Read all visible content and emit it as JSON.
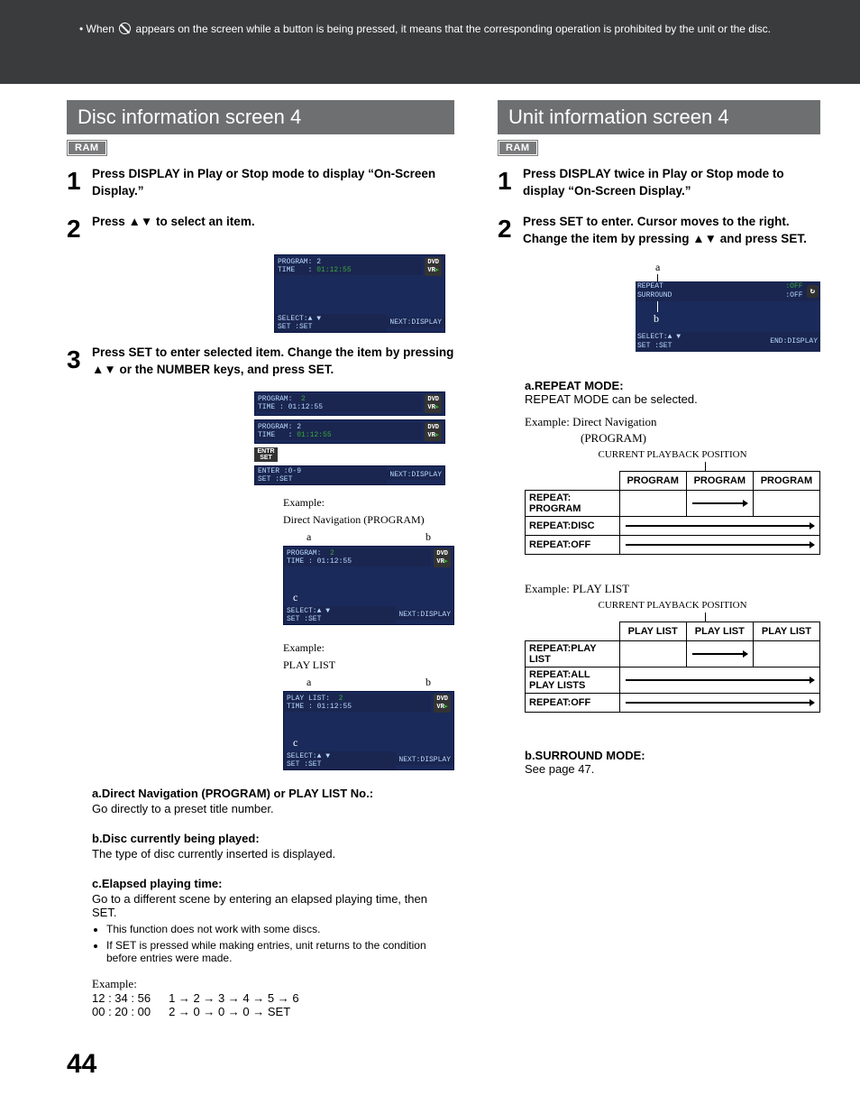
{
  "top_note": {
    "prefix": "• When ",
    "suffix": " appears on the screen while a button is being pressed, it means that the corresponding operation is prohibited by the unit or the disc."
  },
  "left": {
    "title": "Disc information screen 4",
    "ram": "RAM",
    "steps": {
      "s1": "Press DISPLAY in Play or Stop mode to display “On-Screen Display.”",
      "s2_pre": "Press ",
      "s2_post": " to select an item.",
      "s3_a": "Press SET to enter selected item. Change the item by pressing ",
      "s3_b": " or the NUMBER keys, and press SET."
    },
    "osd_common": {
      "program_line": "PROGRAM:  2",
      "time_line": "TIME   : 01:12:55",
      "playlist_line": "PLAY LIST:  2",
      "badge": "DVD VR",
      "entr_set": "ENTR\nSET",
      "enter_line": "ENTER :0-9",
      "set_line": "SET   :SET",
      "select_line": "SELECT:▲ ▼",
      "next": "NEXT:DISPLAY"
    },
    "ex1_label": "Example:",
    "ex1_caption": "Direct Navigation (PROGRAM)",
    "ex2_label": "Example:",
    "ex2_caption": "PLAY LIST",
    "desc_a_h": "a.Direct Navigation (PROGRAM) or PLAY LIST No.:",
    "desc_a_p": "Go directly to a preset title number.",
    "desc_b_h": "b.Disc currently being played:",
    "desc_b_p": "The type of disc currently inserted is displayed.",
    "desc_c_h": "c.Elapsed playing time:",
    "desc_c_p": "Go to a different scene by entering an elapsed playing time, then SET.",
    "desc_c_li1": "This function does not work with some discs.",
    "desc_c_li2": "If SET is pressed while making entries, unit returns to the condition before entries were made.",
    "example_label": "Example:",
    "example_row1_time": "12 : 34 : 56",
    "example_row1_seq": "1 → 2 → 3 → 4 → 5 → 6",
    "example_row2_time": "00 : 20 : 00",
    "example_row2_seq": "2 → 0 → 0 → 0 → SET"
  },
  "right": {
    "title": "Unit information screen 4",
    "ram": "RAM",
    "steps": {
      "s1": "Press DISPLAY twice in Play or Stop mode  to display “On-Screen Display.”",
      "s2_a": "Press SET to enter. Cursor moves to the right. Change the item by pressing ",
      "s2_b": " and press SET."
    },
    "unit_osd": {
      "repeat": "REPEAT",
      "surround": "SURROUND",
      "off": ":OFF",
      "select": "SELECT:▲ ▼",
      "set": "SET   :SET",
      "end": "END:DISPLAY",
      "a": "a",
      "b": "b",
      "icon": "↻"
    },
    "repeat_h": "a.REPEAT MODE:",
    "repeat_p": "REPEAT MODE can be selected.",
    "ex1_label": "Example:  Direct Navigation",
    "ex1_sub": "(PROGRAM)",
    "cpp": "CURRENT PLAYBACK POSITION",
    "table1": {
      "col": "PROGRAM",
      "rows": [
        "REPEAT: PROGRAM",
        "REPEAT:DISC",
        "REPEAT:OFF"
      ]
    },
    "ex2_label": "Example:  PLAY LIST",
    "table2": {
      "col": "PLAY LIST",
      "rows": [
        "REPEAT:PLAY LIST",
        "REPEAT:ALL PLAY LISTS",
        "REPEAT:OFF"
      ]
    },
    "surround_h": "b.SURROUND MODE:",
    "surround_p": "See page 47."
  },
  "page_number": "44"
}
